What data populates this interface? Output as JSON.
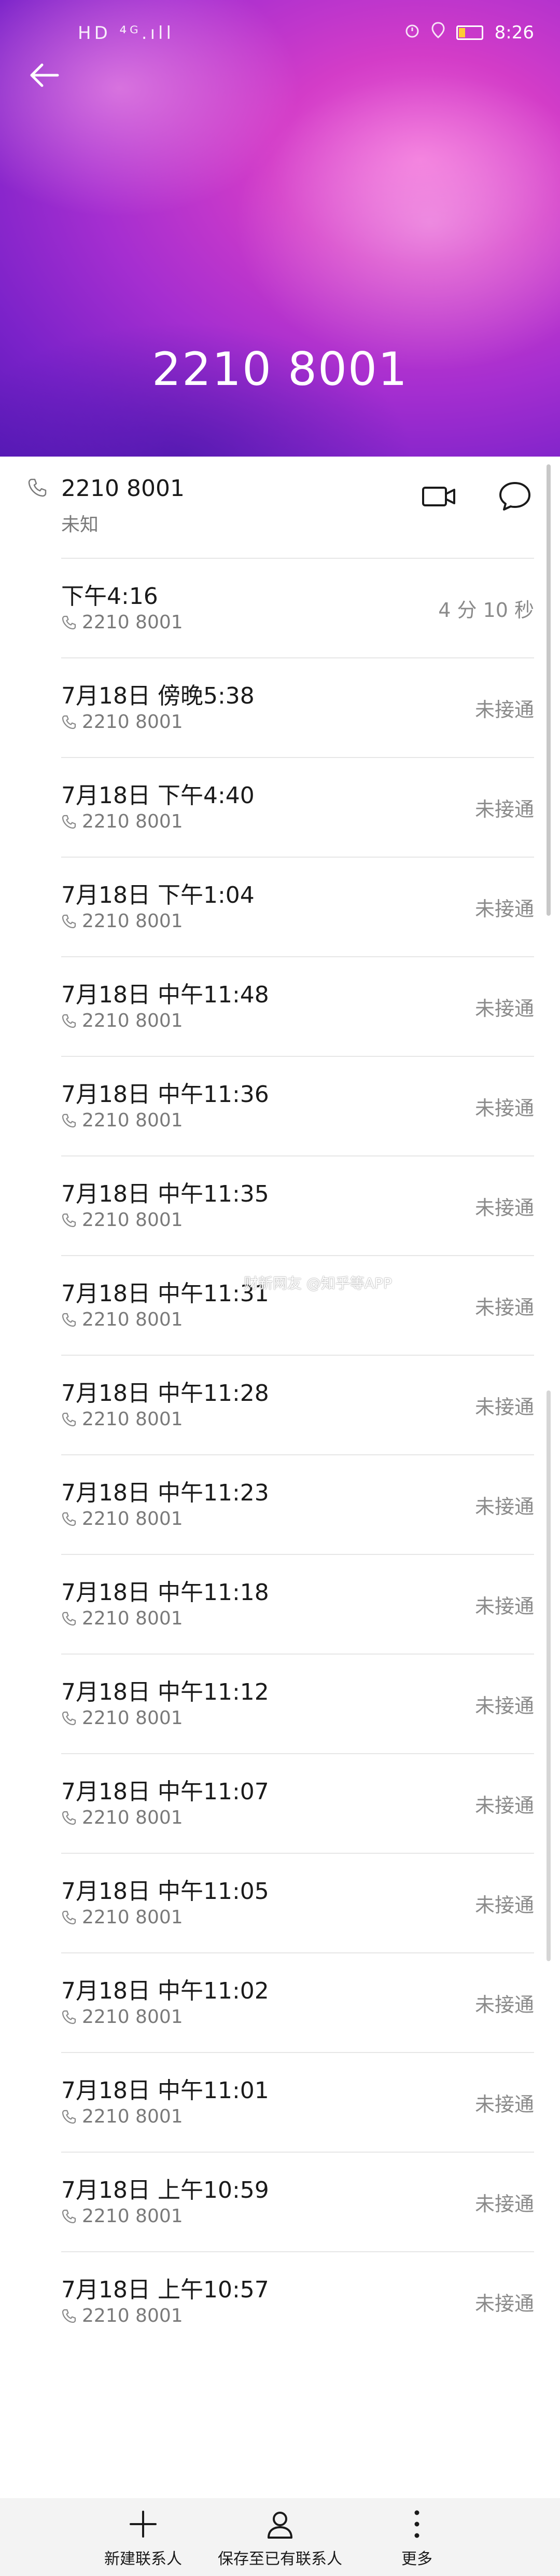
{
  "status_bar": {
    "left_text": "HD ⁴ᴳ.ıll",
    "time": "8:26"
  },
  "header": {
    "number": "2210 8001",
    "back_icon": "back-arrow-icon"
  },
  "contact": {
    "number": "2210 8001",
    "label": "未知"
  },
  "call_log": [
    {
      "time": "下午4:16",
      "number": "2210 8001",
      "status": "4 分 10 秒"
    },
    {
      "time": "7月18日 傍晚5:38",
      "number": "2210 8001",
      "status": "未接通"
    },
    {
      "time": "7月18日 下午4:40",
      "number": "2210 8001",
      "status": "未接通"
    },
    {
      "time": "7月18日 下午1:04",
      "number": "2210 8001",
      "status": "未接通"
    },
    {
      "time": "7月18日 中午11:48",
      "number": "2210 8001",
      "status": "未接通"
    },
    {
      "time": "7月18日 中午11:36",
      "number": "2210 8001",
      "status": "未接通"
    },
    {
      "time": "7月18日 中午11:35",
      "number": "2210 8001",
      "status": "未接通"
    },
    {
      "time": "7月18日 中午11:31",
      "number": "2210 8001",
      "status": "未接通"
    },
    {
      "time": "7月18日 中午11:28",
      "number": "2210 8001",
      "status": "未接通"
    },
    {
      "time": "7月18日 中午11:23",
      "number": "2210 8001",
      "status": "未接通"
    },
    {
      "time": "7月18日 中午11:18",
      "number": "2210 8001",
      "status": "未接通"
    },
    {
      "time": "7月18日 中午11:12",
      "number": "2210 8001",
      "status": "未接通"
    },
    {
      "time": "7月18日 中午11:07",
      "number": "2210 8001",
      "status": "未接通"
    },
    {
      "time": "7月18日 中午11:05",
      "number": "2210 8001",
      "status": "未接通"
    },
    {
      "time": "7月18日 中午11:02",
      "number": "2210 8001",
      "status": "未接通"
    },
    {
      "time": "7月18日 中午11:01",
      "number": "2210 8001",
      "status": "未接通"
    },
    {
      "time": "7月18日 上午10:59",
      "number": "2210 8001",
      "status": "未接通"
    },
    {
      "time": "7月18日 上午10:57",
      "number": "2210 8001",
      "status": "未接通"
    }
  ],
  "watermark": "财新网友 @知乎等APP",
  "bottom_bar": {
    "new_contact": "新建联系人",
    "save_existing": "保存至已有联系人",
    "more": "更多"
  },
  "colors": {
    "header_gradient_main": "#a52ed0",
    "header_gradient_light": "#f06ad8",
    "secondary_text": "#7a7a7a",
    "divider": "#e6e6e6"
  }
}
